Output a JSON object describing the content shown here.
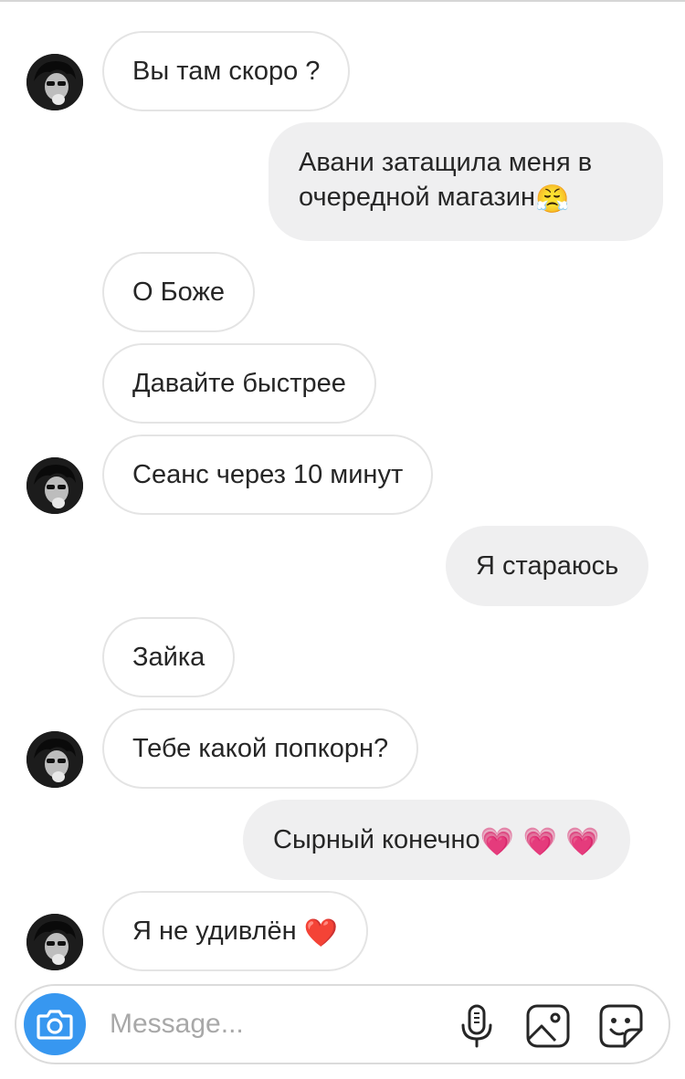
{
  "thread": {
    "messages": [
      {
        "sender": "them",
        "text": "Вы там скоро ?"
      },
      {
        "sender": "me",
        "text": "Авани затащила меня в очередной магазин",
        "emoji": "😤"
      },
      {
        "sender": "them",
        "text": "О Боже"
      },
      {
        "sender": "them",
        "text": "Давайте быстрее"
      },
      {
        "sender": "them",
        "text": "Сеанс через 10 минут"
      },
      {
        "sender": "me",
        "text": "Я стараюсь"
      },
      {
        "sender": "them",
        "text": "Зайка"
      },
      {
        "sender": "them",
        "text": "Тебе какой попкорн?"
      },
      {
        "sender": "me",
        "text": "Сырный конечно",
        "emoji": "💗 💗 💗"
      },
      {
        "sender": "them",
        "text": "Я не удивлён",
        "emoji": "❤️"
      }
    ]
  },
  "composer": {
    "placeholder": "Message...",
    "icons": [
      "camera-icon",
      "microphone-icon",
      "gallery-icon",
      "sticker-icon"
    ],
    "accent_color": "#3797f0"
  },
  "colors": {
    "incoming_bubble_border": "#e4e4e4",
    "outgoing_bubble_bg": "#efeff0",
    "text": "#262626"
  }
}
